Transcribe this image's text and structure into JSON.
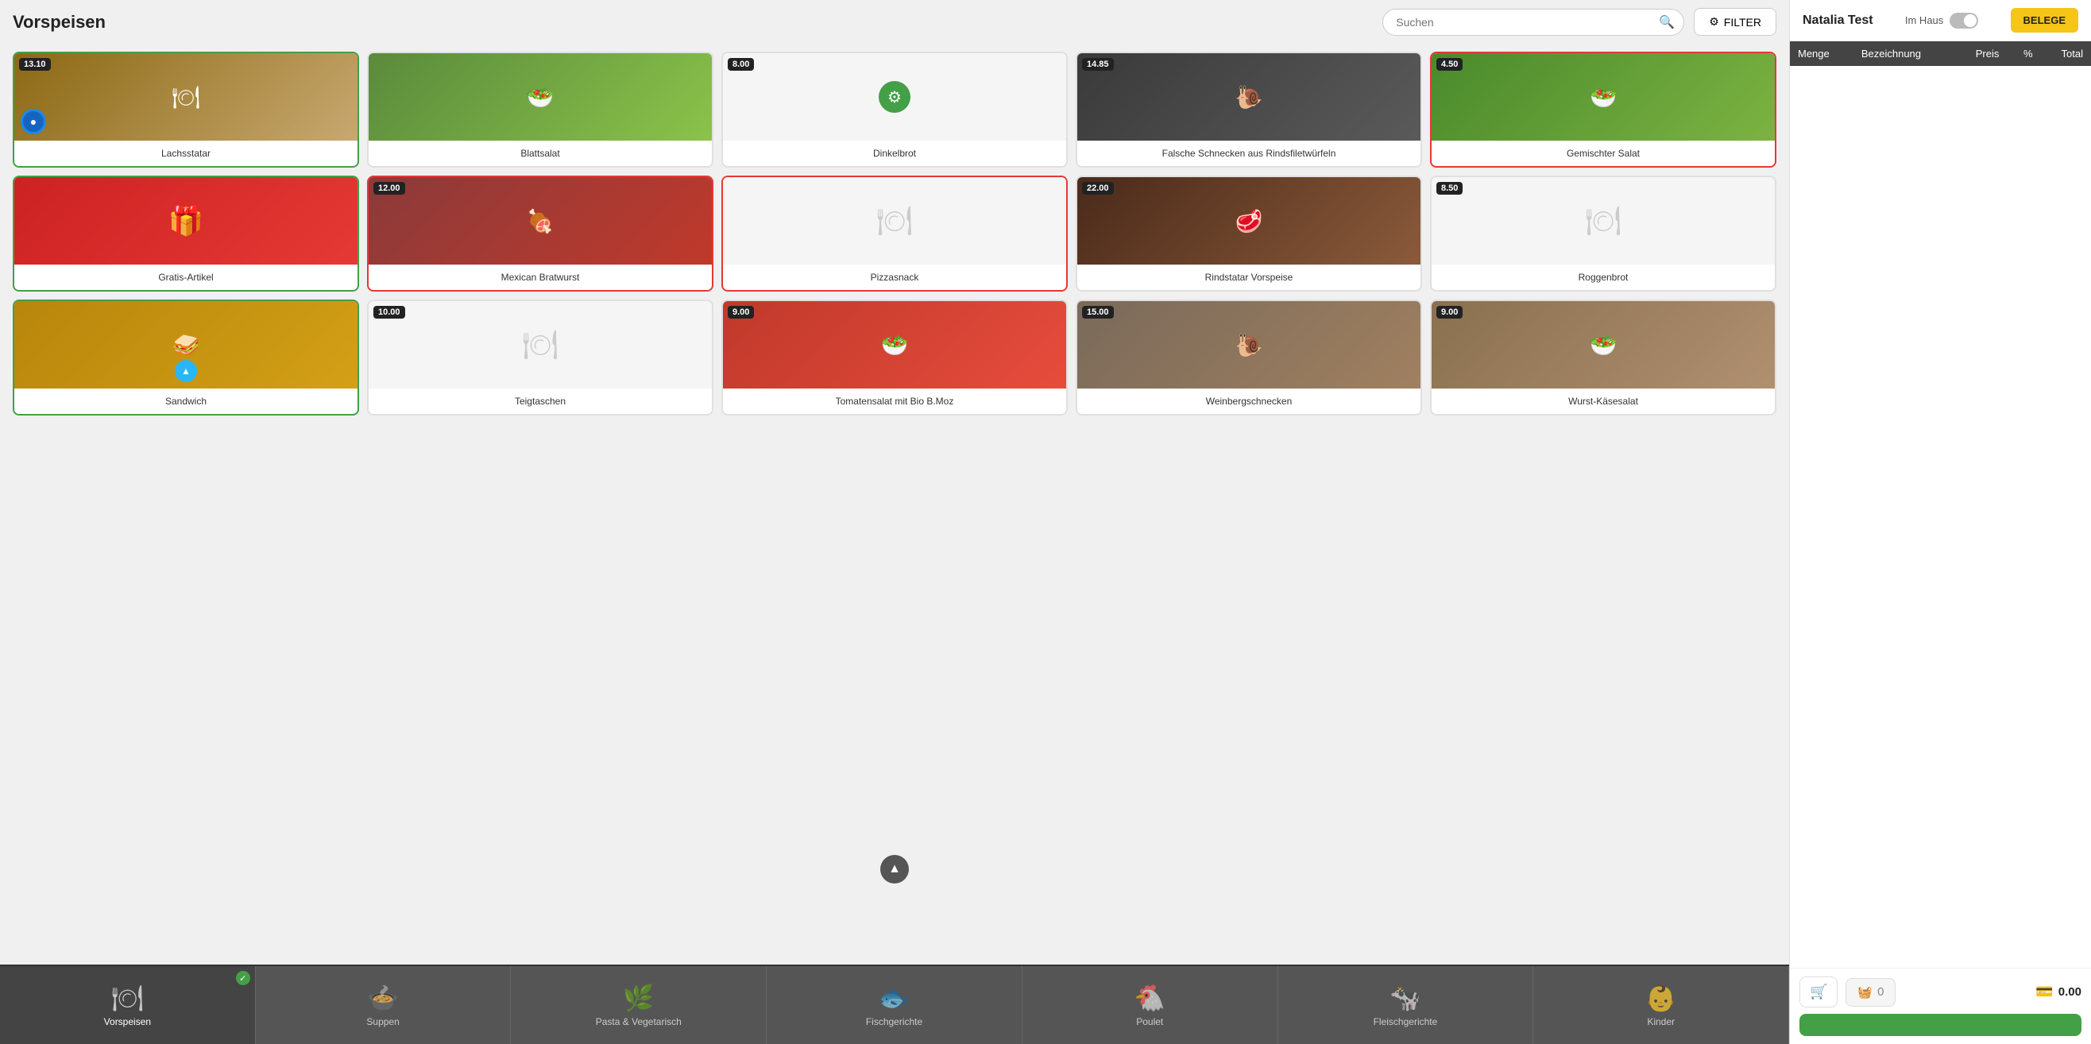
{
  "page": {
    "title": "Vorspeisen"
  },
  "search": {
    "placeholder": "Suchen"
  },
  "filter": {
    "label": "FILTER"
  },
  "customer": {
    "name": "Natalia Test"
  },
  "im_haus": {
    "label": "Im Haus"
  },
  "belege": {
    "label": "BELEGE"
  },
  "table": {
    "columns": [
      "Menge",
      "Bezeichnung",
      "Preis",
      "%",
      "Total"
    ]
  },
  "cart": {
    "count": "0",
    "total": "0.00"
  },
  "menu_items": [
    {
      "id": 1,
      "name": "Lachsstatar",
      "price": "13.10",
      "border": "green",
      "has_image": true,
      "img_class": "img-food",
      "has_overlay": true
    },
    {
      "id": 2,
      "name": "Blattsalat",
      "price": "",
      "border": "none",
      "has_image": true,
      "img_class": "img-salad"
    },
    {
      "id": 3,
      "name": "Dinkelbrot",
      "price": "8.00",
      "border": "none",
      "has_image": false,
      "img_class": "",
      "has_icon": true,
      "icon": "⚙"
    },
    {
      "id": 4,
      "name": "Falsche Schnecken aus Rindsfiletwürfeln",
      "price": "14.85",
      "border": "none",
      "has_image": true,
      "img_class": "img-snail"
    },
    {
      "id": 5,
      "name": "Gemischter Salat",
      "price": "4.50",
      "border": "red",
      "has_image": true,
      "img_class": "img-greens"
    },
    {
      "id": 6,
      "name": "Gratis-Artikel",
      "price": "",
      "border": "green",
      "has_image": true,
      "img_class": "img-gift"
    },
    {
      "id": 7,
      "name": "Mexican Bratwurst",
      "price": "12.00",
      "border": "red",
      "has_image": true,
      "img_class": "img-meat"
    },
    {
      "id": 8,
      "name": "Pizzasnack",
      "price": "",
      "border": "red",
      "has_image": false,
      "img_class": ""
    },
    {
      "id": 9,
      "name": "Rindstatar Vorspeise",
      "price": "22.00",
      "border": "none",
      "has_image": true,
      "img_class": "img-steak"
    },
    {
      "id": 10,
      "name": "Roggenbrot",
      "price": "8.50",
      "border": "none",
      "has_image": false,
      "img_class": ""
    },
    {
      "id": 11,
      "name": "Sandwich",
      "price": "",
      "border": "green",
      "has_image": true,
      "img_class": "img-sandwich",
      "has_overlay2": true
    },
    {
      "id": 12,
      "name": "Teigtaschen",
      "price": "10.00",
      "border": "none",
      "has_image": false,
      "img_class": ""
    },
    {
      "id": 13,
      "name": "Tomatensalat mit Bio B.Moz",
      "price": "9.00",
      "border": "none",
      "has_image": true,
      "img_class": "img-tomato"
    },
    {
      "id": 14,
      "name": "Weinbergschnecken",
      "price": "15.00",
      "border": "none",
      "has_image": true,
      "img_class": "img-snails"
    },
    {
      "id": 15,
      "name": "Wurst-Käsesalat",
      "price": "9.00",
      "border": "none",
      "has_image": true,
      "img_class": "img-wurst"
    }
  ],
  "categories": [
    {
      "id": "vorspeisen",
      "label": "Vorspeisen",
      "active": true,
      "checked": true
    },
    {
      "id": "suppen",
      "label": "Suppen",
      "active": false
    },
    {
      "id": "pasta",
      "label": "Pasta & Vegetarisch",
      "active": false
    },
    {
      "id": "fisch",
      "label": "Fischgerichte",
      "active": false
    },
    {
      "id": "poulet",
      "label": "Poulet",
      "active": false
    },
    {
      "id": "fleisch",
      "label": "Fleischgerichte",
      "active": false
    },
    {
      "id": "kinder",
      "label": "Kinder",
      "active": false
    }
  ]
}
